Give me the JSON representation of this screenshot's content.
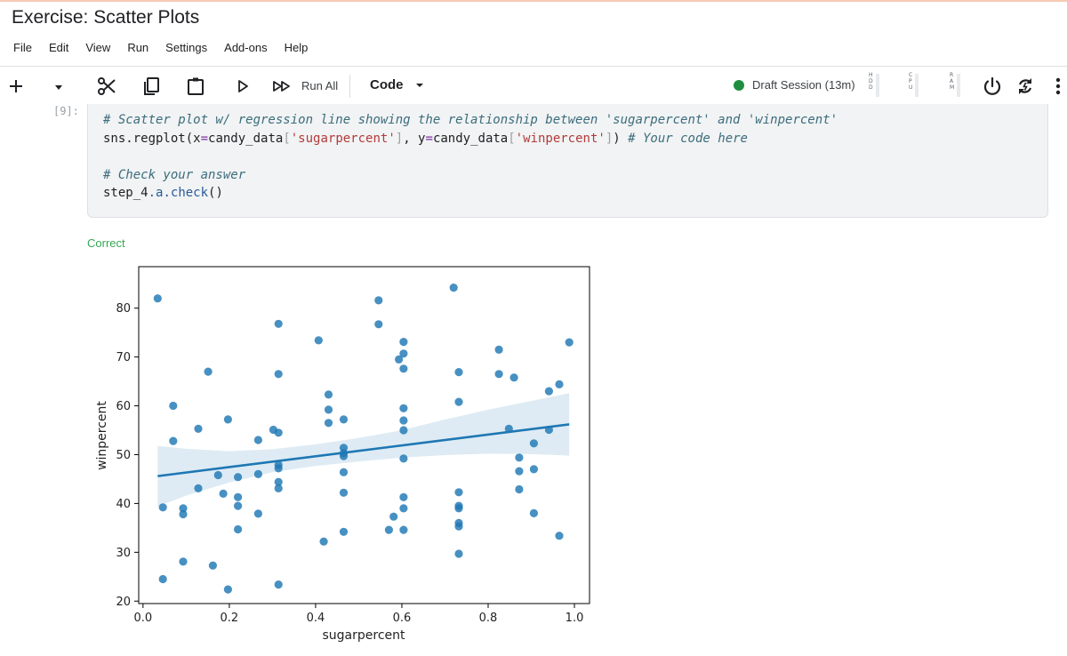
{
  "notebook": {
    "title": "Exercise: Scatter Plots"
  },
  "menu": [
    "File",
    "Edit",
    "View",
    "Run",
    "Settings",
    "Add-ons",
    "Help"
  ],
  "toolbar": {
    "run_all_label": "Run All",
    "cell_type": "Code",
    "session": "Draft Session (13m)",
    "meters": [
      {
        "letters": [
          "H",
          "D",
          "D"
        ]
      },
      {
        "letters": [
          "C",
          "P",
          "U"
        ]
      },
      {
        "letters": [
          "R",
          "A",
          "M"
        ]
      }
    ],
    "icons": [
      "plus-icon",
      "chevron-down-icon",
      "scissors-icon",
      "copy-icon",
      "clipboard-icon",
      "play-icon",
      "fast-forward-icon",
      "power-icon",
      "refresh-icon",
      "more-vert-icon"
    ]
  },
  "cell": {
    "prompt": "[9]:",
    "line1": "# Scatter plot w/ regression line showing the relationship between 'sugarpercent' and 'winpercent'",
    "line2": {
      "p1": "sns.regplot(x",
      "p2": "=",
      "p3": "candy_data",
      "p4": "[",
      "p5": "'sugarpercent'",
      "p6": "]",
      "p7": ", y",
      "p8": "=",
      "p9": "candy_data",
      "p10": "[",
      "p11": "'winpercent'",
      "p12": "]",
      "p13": ") ",
      "p14": "# Your code here"
    },
    "line4": "# Check your answer",
    "line5": {
      "p1": "step_4",
      "p2": ".",
      "p3": "a",
      "p4": ".",
      "p5": "check",
      "p6": "()"
    }
  },
  "output": {
    "status": "Correct"
  },
  "chart_data": {
    "type": "scatter",
    "xlabel": "sugarpercent",
    "ylabel": "winpercent",
    "xlim": [
      -0.01,
      1.035
    ],
    "ylim": [
      19.5,
      88.5
    ],
    "xticks": [
      0.0,
      0.2,
      0.4,
      0.6,
      0.8,
      1.0
    ],
    "xtick_labels": [
      "0.0",
      "0.2",
      "0.4",
      "0.6",
      "0.8",
      "1.0"
    ],
    "yticks": [
      20,
      30,
      40,
      50,
      60,
      70,
      80
    ],
    "ytick_labels": [
      "20",
      "30",
      "40",
      "50",
      "60",
      "70",
      "80"
    ],
    "grid": false,
    "point_color": "#1f77b4",
    "regression": {
      "x": [
        0.034,
        0.988
      ],
      "y": [
        45.6,
        56.2
      ]
    },
    "ci_band": {
      "x": [
        0.034,
        0.1,
        0.2,
        0.3,
        0.4,
        0.5,
        0.6,
        0.7,
        0.8,
        0.9,
        0.988
      ],
      "lower": [
        39.4,
        41.6,
        44.3,
        46.4,
        47.7,
        48.6,
        49.4,
        49.9,
        50.2,
        50.1,
        49.8
      ],
      "upper": [
        51.8,
        51.2,
        50.7,
        51.1,
        52.1,
        53.4,
        55.0,
        57.2,
        59.2,
        61.0,
        62.6
      ]
    },
    "points": [
      [
        0.034,
        82.0
      ],
      [
        0.046,
        39.2
      ],
      [
        0.046,
        24.5
      ],
      [
        0.07,
        60.0
      ],
      [
        0.07,
        52.8
      ],
      [
        0.093,
        39.0
      ],
      [
        0.093,
        37.8
      ],
      [
        0.093,
        28.1
      ],
      [
        0.128,
        55.3
      ],
      [
        0.128,
        43.1
      ],
      [
        0.151,
        67.0
      ],
      [
        0.162,
        27.3
      ],
      [
        0.174,
        45.8
      ],
      [
        0.186,
        42.0
      ],
      [
        0.197,
        57.2
      ],
      [
        0.197,
        22.4
      ],
      [
        0.22,
        41.3
      ],
      [
        0.22,
        39.5
      ],
      [
        0.22,
        45.4
      ],
      [
        0.22,
        34.7
      ],
      [
        0.267,
        53.0
      ],
      [
        0.267,
        46.0
      ],
      [
        0.267,
        37.9
      ],
      [
        0.302,
        55.1
      ],
      [
        0.314,
        54.5
      ],
      [
        0.314,
        47.9
      ],
      [
        0.314,
        47.2
      ],
      [
        0.314,
        44.4
      ],
      [
        0.314,
        43.1
      ],
      [
        0.314,
        76.8
      ],
      [
        0.314,
        66.5
      ],
      [
        0.314,
        23.4
      ],
      [
        0.407,
        73.4
      ],
      [
        0.419,
        32.2
      ],
      [
        0.43,
        62.3
      ],
      [
        0.43,
        59.2
      ],
      [
        0.43,
        56.5
      ],
      [
        0.465,
        57.2
      ],
      [
        0.465,
        51.4
      ],
      [
        0.465,
        50.3
      ],
      [
        0.465,
        49.7
      ],
      [
        0.465,
        46.4
      ],
      [
        0.465,
        42.2
      ],
      [
        0.465,
        34.2
      ],
      [
        0.546,
        81.6
      ],
      [
        0.546,
        76.7
      ],
      [
        0.57,
        34.6
      ],
      [
        0.581,
        37.3
      ],
      [
        0.593,
        69.5
      ],
      [
        0.604,
        73.1
      ],
      [
        0.604,
        70.7
      ],
      [
        0.604,
        67.6
      ],
      [
        0.604,
        59.5
      ],
      [
        0.604,
        57.0
      ],
      [
        0.604,
        55.0
      ],
      [
        0.604,
        49.2
      ],
      [
        0.604,
        41.3
      ],
      [
        0.604,
        39.0
      ],
      [
        0.604,
        34.6
      ],
      [
        0.72,
        84.2
      ],
      [
        0.732,
        66.9
      ],
      [
        0.732,
        60.8
      ],
      [
        0.732,
        42.3
      ],
      [
        0.732,
        39.5
      ],
      [
        0.732,
        39.0
      ],
      [
        0.732,
        36.0
      ],
      [
        0.732,
        35.3
      ],
      [
        0.732,
        29.7
      ],
      [
        0.825,
        71.5
      ],
      [
        0.825,
        66.5
      ],
      [
        0.86,
        65.8
      ],
      [
        0.848,
        55.3
      ],
      [
        0.872,
        49.4
      ],
      [
        0.872,
        46.6
      ],
      [
        0.872,
        42.9
      ],
      [
        0.906,
        52.3
      ],
      [
        0.906,
        47.0
      ],
      [
        0.906,
        38.0
      ],
      [
        0.941,
        63.0
      ],
      [
        0.941,
        55.1
      ],
      [
        0.965,
        64.4
      ],
      [
        0.965,
        33.4
      ],
      [
        0.988,
        73.0
      ]
    ]
  }
}
